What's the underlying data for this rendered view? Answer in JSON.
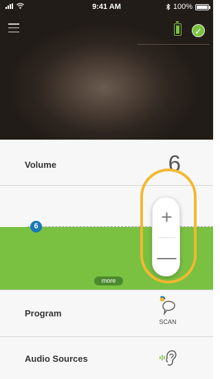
{
  "status": {
    "time": "9:41 AM",
    "battery": "100%"
  },
  "volume": {
    "label": "Volume",
    "value": "6"
  },
  "control": {
    "level_badge": "6",
    "more_label": "more",
    "plus_symbol": "+",
    "minus_symbol": "—"
  },
  "program": {
    "label": "Program",
    "scan_label": "SCAN"
  },
  "audio_sources": {
    "label": "Audio Sources"
  },
  "colors": {
    "accent_green": "#7ac142",
    "ring": "#f3b832",
    "badge": "#1878b8"
  },
  "icons": [
    "signal-icon",
    "wifi-icon",
    "bluetooth-icon",
    "battery-icon",
    "menu-icon",
    "hearing-aid-battery-icon",
    "connected-check-icon",
    "scan-icon",
    "ear-icon"
  ]
}
